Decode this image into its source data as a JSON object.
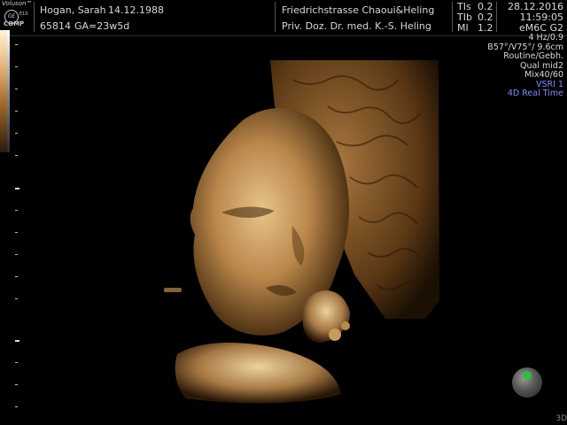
{
  "logo": {
    "brand": "Voluson™",
    "mark": "GE",
    "model": "E10",
    "comp": "COMP"
  },
  "patient": {
    "name": "Hogan, Sarah",
    "dob": "14.12.1988",
    "id": "65814",
    "ga": "GA=23w5d"
  },
  "institution": {
    "name": "Friedrichstrasse Chaoui&Heling",
    "doctor": "Priv. Doz. Dr. med. K.-S. Heling"
  },
  "indices": {
    "tis_label": "TIs",
    "tis_value": "0.2",
    "tib_label": "TIb",
    "tib_value": "0.2",
    "mi_label": "MI",
    "mi_value": "1.2"
  },
  "session": {
    "date": "28.12.2016",
    "time": "11:59:05",
    "probe": "eM6C G2"
  },
  "params": {
    "hz": "4 Hz/0.9",
    "angle": "B57°/V75°/ 9.6cm",
    "preset": "Routine/Gebh.",
    "quality": "Qual mid2",
    "mix": "Mix40/60",
    "vsri": "VSRI 1",
    "mode": "4D Real Time"
  },
  "corner_label": "3D",
  "colors": {
    "accent_blue": "#7f8cff",
    "orientation_dot": "#2fbf3a",
    "skin": "#c89a5a"
  }
}
